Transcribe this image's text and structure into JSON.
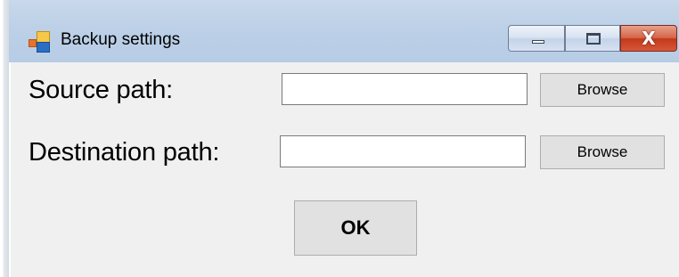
{
  "window": {
    "title": "Backup settings",
    "icon": "app-icon",
    "caption_buttons": [
      "minimize-icon",
      "maximize-icon",
      "close-icon"
    ],
    "close_glyph": "X"
  },
  "form": {
    "source_label": "Source path:",
    "source_value": "",
    "destination_label": "Destination path:",
    "destination_value": "",
    "browse_label": "Browse",
    "ok_label": "OK"
  },
  "colors": {
    "titlebar": "#bcd0e7",
    "client_background": "#f0f0f0",
    "close_button": "#c2391a",
    "button_face": "#e1e1e1"
  }
}
